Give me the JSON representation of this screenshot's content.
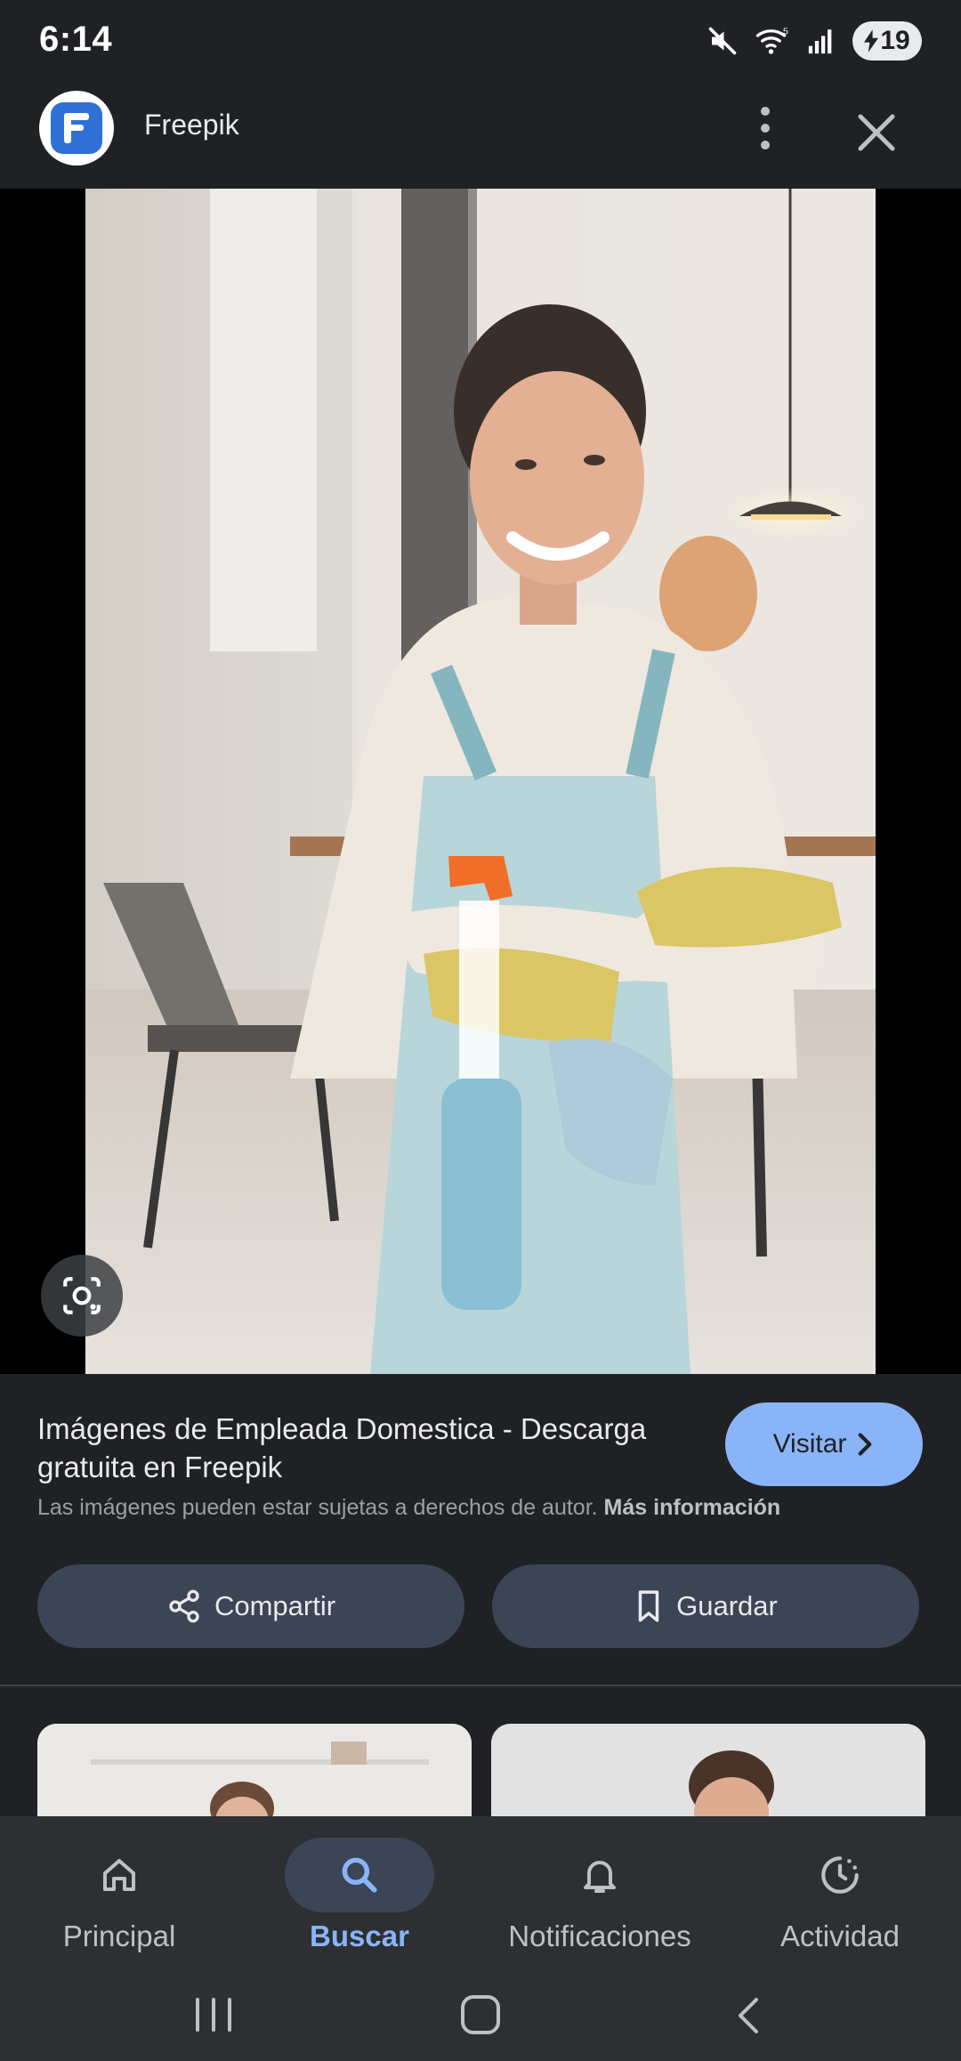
{
  "status_bar": {
    "time": "6:14",
    "battery": "19",
    "icons": [
      "mute-icon",
      "wifi-icon",
      "signal-icon",
      "battery-charging-icon"
    ]
  },
  "header": {
    "site_name": "Freepik",
    "icons": [
      "freepik-logo",
      "more-vert-icon",
      "close-icon"
    ]
  },
  "image": {
    "description_icon": "lens-icon"
  },
  "info": {
    "title": "Imágenes de Empleada Domestica - Descarga gratuita en Freepik",
    "visit_label": "Visitar",
    "copyright_text": "Las imágenes pueden estar sujetas a derechos de autor.",
    "more_info_label": "Más información",
    "share_label": "Compartir",
    "save_label": "Guardar"
  },
  "bottom_nav": {
    "items": [
      {
        "label": "Principal",
        "icon": "home-icon",
        "active": false
      },
      {
        "label": "Buscar",
        "icon": "search-icon",
        "active": true
      },
      {
        "label": "Notificaciones",
        "icon": "bell-icon",
        "active": false
      },
      {
        "label": "Actividad",
        "icon": "activity-icon",
        "active": false
      }
    ]
  },
  "colors": {
    "background": "#202124",
    "accent": "#8ab4f8",
    "pill": "#3c4555",
    "nav_background": "#2d2f33"
  }
}
